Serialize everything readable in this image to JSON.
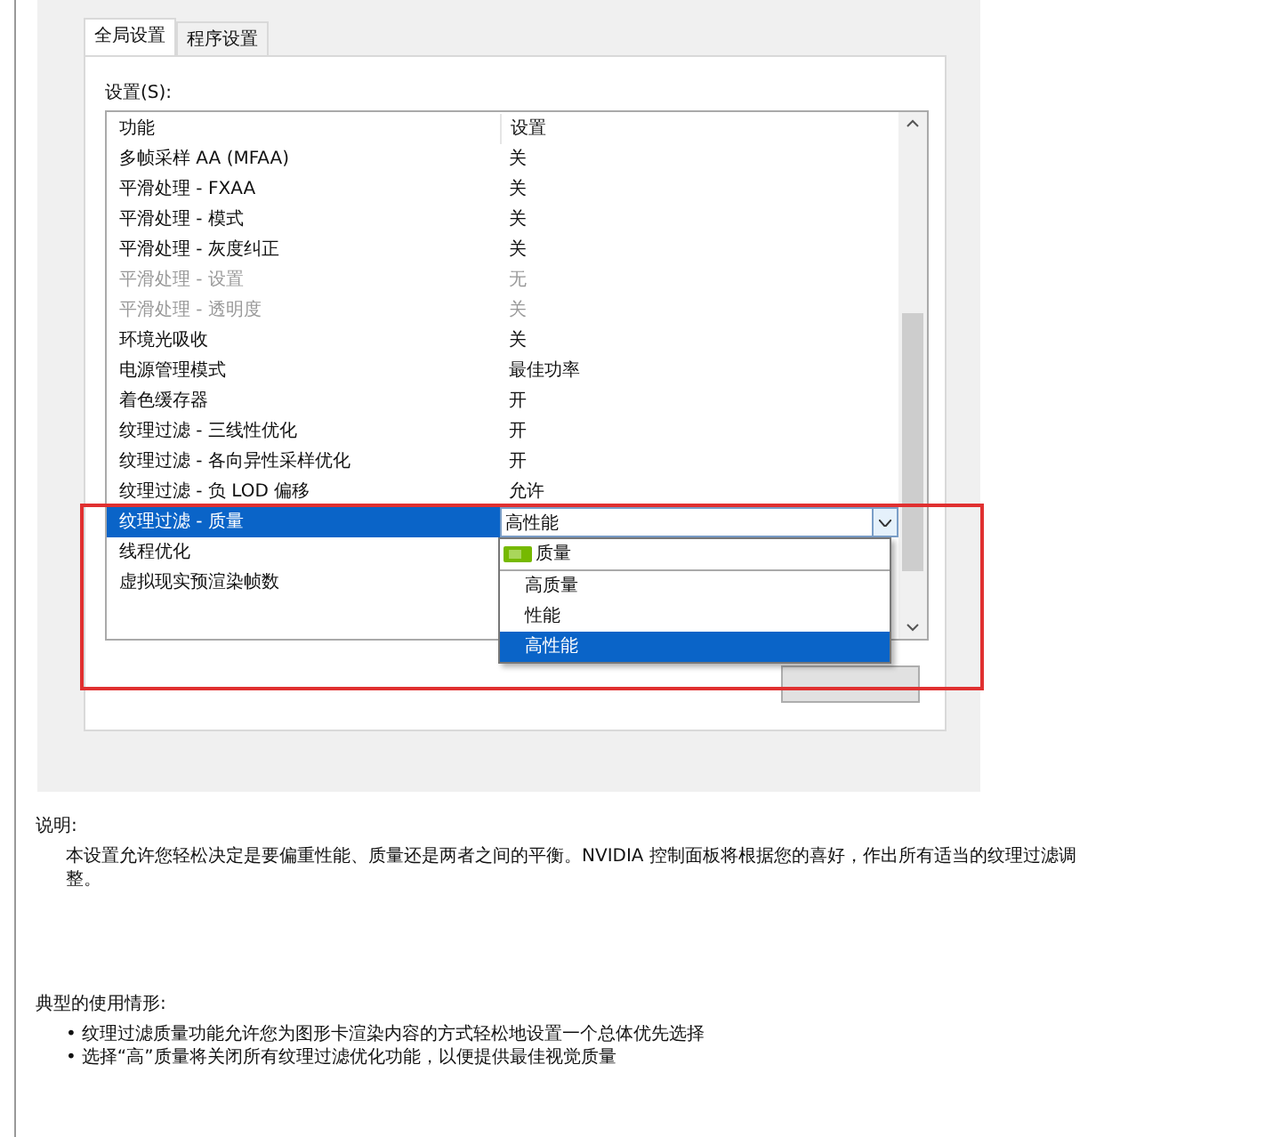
{
  "tabs": [
    {
      "label": "全局设置",
      "selected": true
    },
    {
      "label": "程序设置",
      "selected": false
    }
  ],
  "settings_label": "设置(S):",
  "columns": [
    "功能",
    "设置"
  ],
  "rows": [
    {
      "feature": "多帧采样 AA (MFAA)",
      "value": "关",
      "disabled": false,
      "selected": false
    },
    {
      "feature": "平滑处理 - FXAA",
      "value": "关",
      "disabled": false,
      "selected": false
    },
    {
      "feature": "平滑处理 - 模式",
      "value": "关",
      "disabled": false,
      "selected": false
    },
    {
      "feature": "平滑处理 - 灰度纠正",
      "value": "关",
      "disabled": false,
      "selected": false
    },
    {
      "feature": "平滑处理 - 设置",
      "value": "无",
      "disabled": true,
      "selected": false
    },
    {
      "feature": "平滑处理 - 透明度",
      "value": "关",
      "disabled": true,
      "selected": false
    },
    {
      "feature": "环境光吸收",
      "value": "关",
      "disabled": false,
      "selected": false
    },
    {
      "feature": "电源管理模式",
      "value": "最佳功率",
      "disabled": false,
      "selected": false
    },
    {
      "feature": "着色缓存器",
      "value": "开",
      "disabled": false,
      "selected": false
    },
    {
      "feature": "纹理过滤 - 三线性优化",
      "value": "开",
      "disabled": false,
      "selected": false
    },
    {
      "feature": "纹理过滤 - 各向异性采样优化",
      "value": "开",
      "disabled": false,
      "selected": false
    },
    {
      "feature": "纹理过滤 - 负 LOD 偏移",
      "value": "允许",
      "disabled": false,
      "selected": false
    },
    {
      "feature": "纹理过滤 - 质量",
      "value": "高性能",
      "disabled": false,
      "selected": true
    },
    {
      "feature": "线程优化",
      "disabled": false,
      "selected": false
    },
    {
      "feature": "虚拟现实预渲染帧数",
      "disabled": false,
      "selected": false
    }
  ],
  "dropdown_options": [
    {
      "label": "质量",
      "kind": "header",
      "selected": false
    },
    {
      "label": "高质量",
      "kind": "option",
      "selected": false
    },
    {
      "label": "性能",
      "kind": "option",
      "selected": false
    },
    {
      "label": "高性能",
      "kind": "option",
      "selected": true
    }
  ],
  "description_title": "说明:",
  "description": "本设置允许您轻松决定是要偏重性能、质量还是两者之间的平衡。NVIDIA 控制面板将根据您的喜好，作出所有适当的纹理过滤调整。",
  "usage_title": "典型的使用情形:",
  "usage_items": [
    {
      "marker": "•",
      "text": "纹理过滤质量功能允许您为图形卡渲染内容的方式轻松地设置一个总体优先选择"
    },
    {
      "marker": "•",
      "text": "选择“高”质量将关闭所有纹理过滤优化功能，以便提供最佳视觉质量"
    }
  ]
}
